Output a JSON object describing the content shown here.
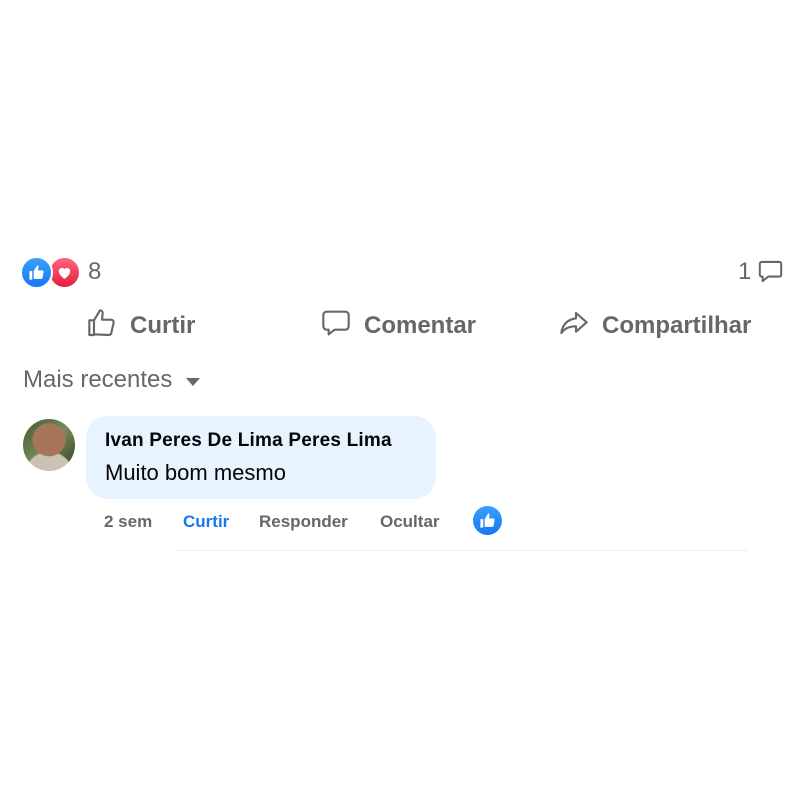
{
  "reactions": {
    "count": "8",
    "types": [
      "like-icon",
      "love-icon"
    ],
    "colors": {
      "like": "#1877f2",
      "love": "#e41e3f"
    }
  },
  "comments_count": "1",
  "actions": {
    "like_label": "Curtir",
    "comment_label": "Comentar",
    "share_label": "Compartilhar"
  },
  "sort": {
    "label": "Mais recentes"
  },
  "comment": {
    "author": "Ivan Peres De Lima Peres Lima",
    "text": "Muito bom mesmo",
    "time": "2 sem",
    "like_label": "Curtir",
    "reply_label": "Responder",
    "hide_label": "Ocultar",
    "reaction": "like-icon"
  },
  "colors": {
    "accent": "#1877f2",
    "muted_text": "#65676b",
    "bubble": "#e7f3ff"
  }
}
